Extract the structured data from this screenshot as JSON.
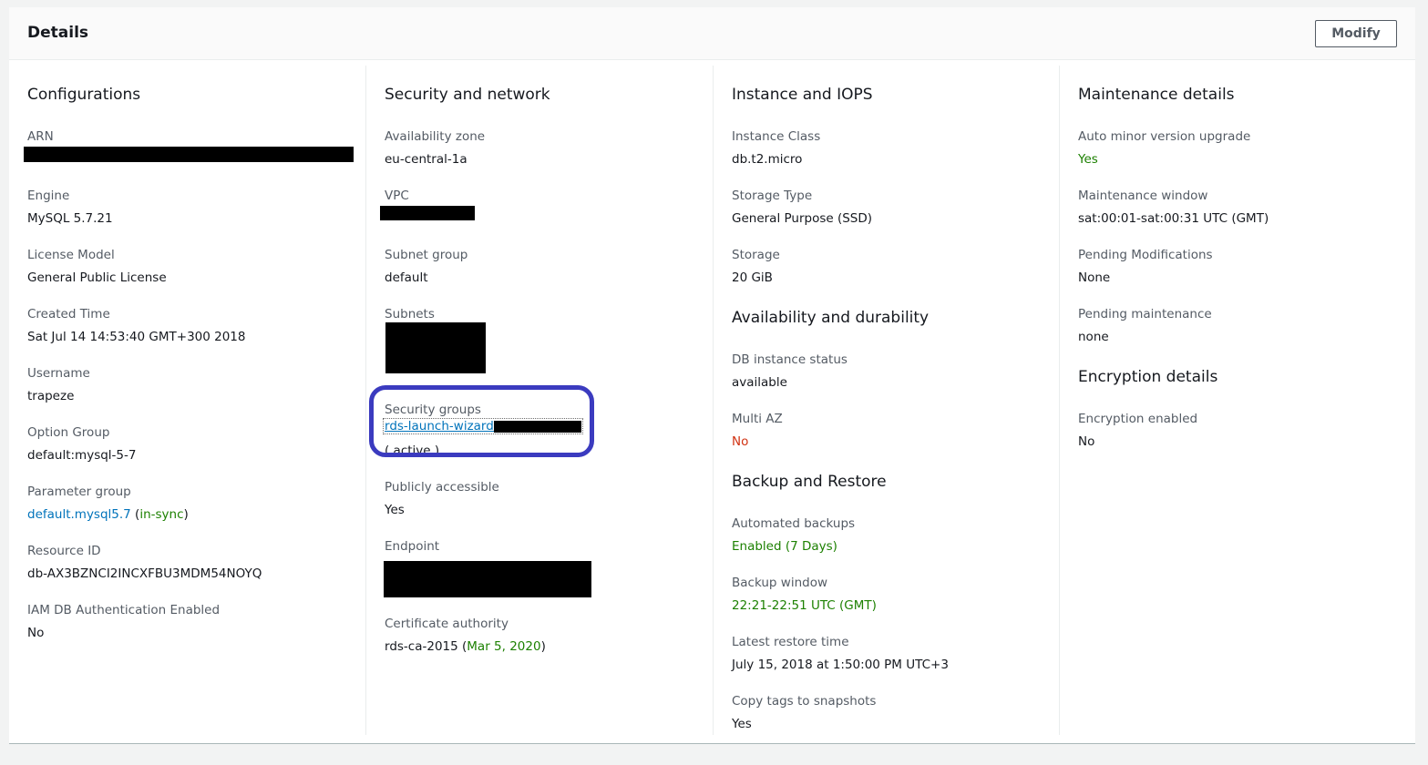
{
  "panel": {
    "title": "Details",
    "modify_label": "Modify"
  },
  "configurations": {
    "title": "Configurations",
    "arn_label": "ARN",
    "engine_label": "Engine",
    "engine_value": "MySQL 5.7.21",
    "license_label": "License Model",
    "license_value": "General Public License",
    "created_label": "Created Time",
    "created_value": "Sat Jul 14 14:53:40 GMT+300 2018",
    "username_label": "Username",
    "username_value": "trapeze",
    "option_group_label": "Option Group",
    "option_group_value": "default:mysql-5-7",
    "parameter_group_label": "Parameter group",
    "parameter_group_link": "default.mysql5.7",
    "parameter_group_status": "in-sync",
    "resource_id_label": "Resource ID",
    "resource_id_value": "db-AX3BZNCI2INCXFBU3MDM54NOYQ",
    "iam_label": "IAM DB Authentication Enabled",
    "iam_value": "No"
  },
  "security": {
    "title": "Security and network",
    "az_label": "Availability zone",
    "az_value": "eu-central-1a",
    "vpc_label": "VPC",
    "subnet_group_label": "Subnet group",
    "subnet_group_value": "default",
    "subnets_label": "Subnets",
    "sg_label": "Security groups",
    "sg_link": "rds-launch-wizard-",
    "sg_status": "( active )",
    "public_label": "Publicly accessible",
    "public_value": "Yes",
    "endpoint_label": "Endpoint",
    "ca_label": "Certificate authority",
    "ca_value": "rds-ca-2015",
    "ca_date": "Mar 5, 2020"
  },
  "instance": {
    "title": "Instance and IOPS",
    "class_label": "Instance Class",
    "class_value": "db.t2.micro",
    "storage_type_label": "Storage Type",
    "storage_type_value": "General Purpose (SSD)",
    "storage_label": "Storage",
    "storage_value": "20 GiB"
  },
  "availability": {
    "title": "Availability and durability",
    "status_label": "DB instance status",
    "status_value": "available",
    "multiaz_label": "Multi AZ",
    "multiaz_value": "No"
  },
  "backup": {
    "title": "Backup and Restore",
    "auto_label": "Automated backups",
    "auto_value": "Enabled (7 Days)",
    "window_label": "Backup window",
    "window_value": "22:21-22:51 UTC (GMT)",
    "restore_label": "Latest restore time",
    "restore_value": "July 15, 2018 at 1:50:00 PM UTC+3",
    "copy_tags_label": "Copy tags to snapshots",
    "copy_tags_value": "Yes"
  },
  "maintenance": {
    "title": "Maintenance details",
    "auto_minor_label": "Auto minor version upgrade",
    "auto_minor_value": "Yes",
    "window_label": "Maintenance window",
    "window_value": "sat:00:01-sat:00:31 UTC (GMT)",
    "pending_mod_label": "Pending Modifications",
    "pending_mod_value": "None",
    "pending_maint_label": "Pending maintenance",
    "pending_maint_value": "none"
  },
  "encryption": {
    "title": "Encryption details",
    "enabled_label": "Encryption enabled",
    "enabled_value": "No"
  },
  "colors": {
    "link": "#0073bb",
    "success": "#1d8102",
    "error": "#d13212",
    "highlight": "#3b3bbf"
  }
}
